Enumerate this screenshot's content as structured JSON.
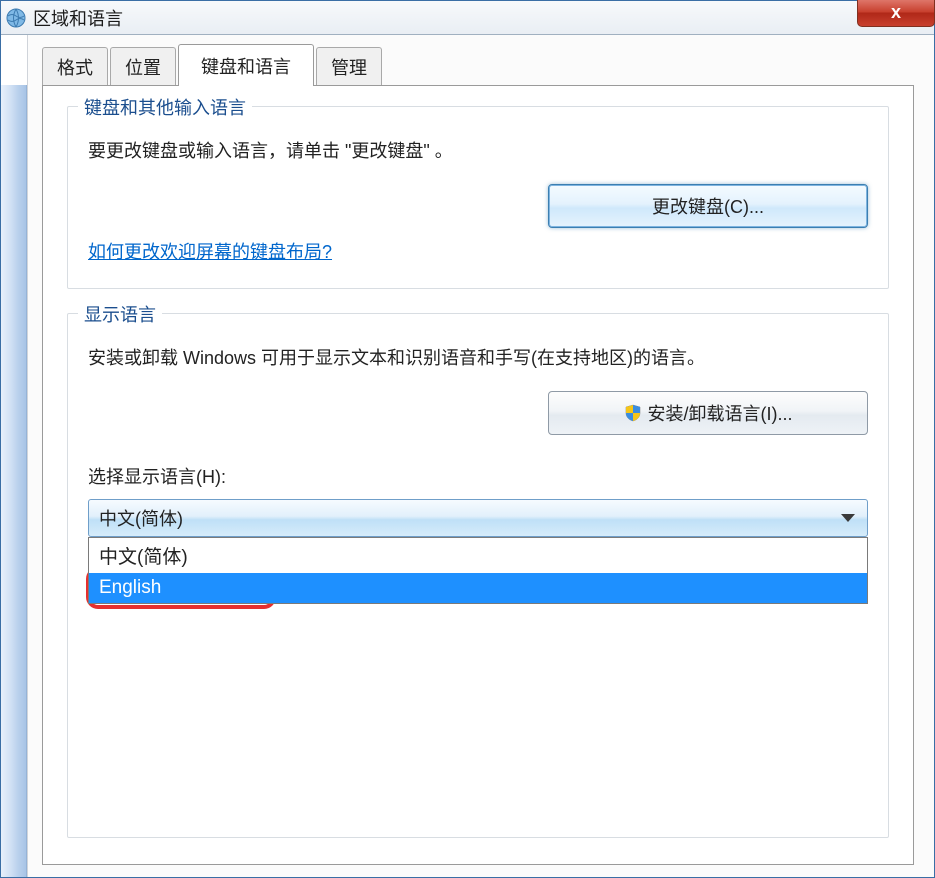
{
  "window": {
    "title": "区域和语言",
    "close_label": "x"
  },
  "tabs": [
    {
      "label": "格式",
      "active": false
    },
    {
      "label": "位置",
      "active": false
    },
    {
      "label": "键盘和语言",
      "active": true
    },
    {
      "label": "管理",
      "active": false
    }
  ],
  "keyboard_group": {
    "legend": "键盘和其他输入语言",
    "description": "要更改键盘或输入语言，请单击 \"更改键盘\" 。",
    "change_button": "更改键盘(C)...",
    "link": "如何更改欢迎屏幕的键盘布局?"
  },
  "display_group": {
    "legend": "显示语言",
    "description": "安装或卸载 Windows 可用于显示文本和识别语音和手写(在支持地区)的语言。",
    "install_button": "安装/卸载语言(I)...",
    "select_label": "选择显示语言(H):",
    "selected": "中文(简体)",
    "options": [
      "中文(简体)",
      "English"
    ]
  }
}
